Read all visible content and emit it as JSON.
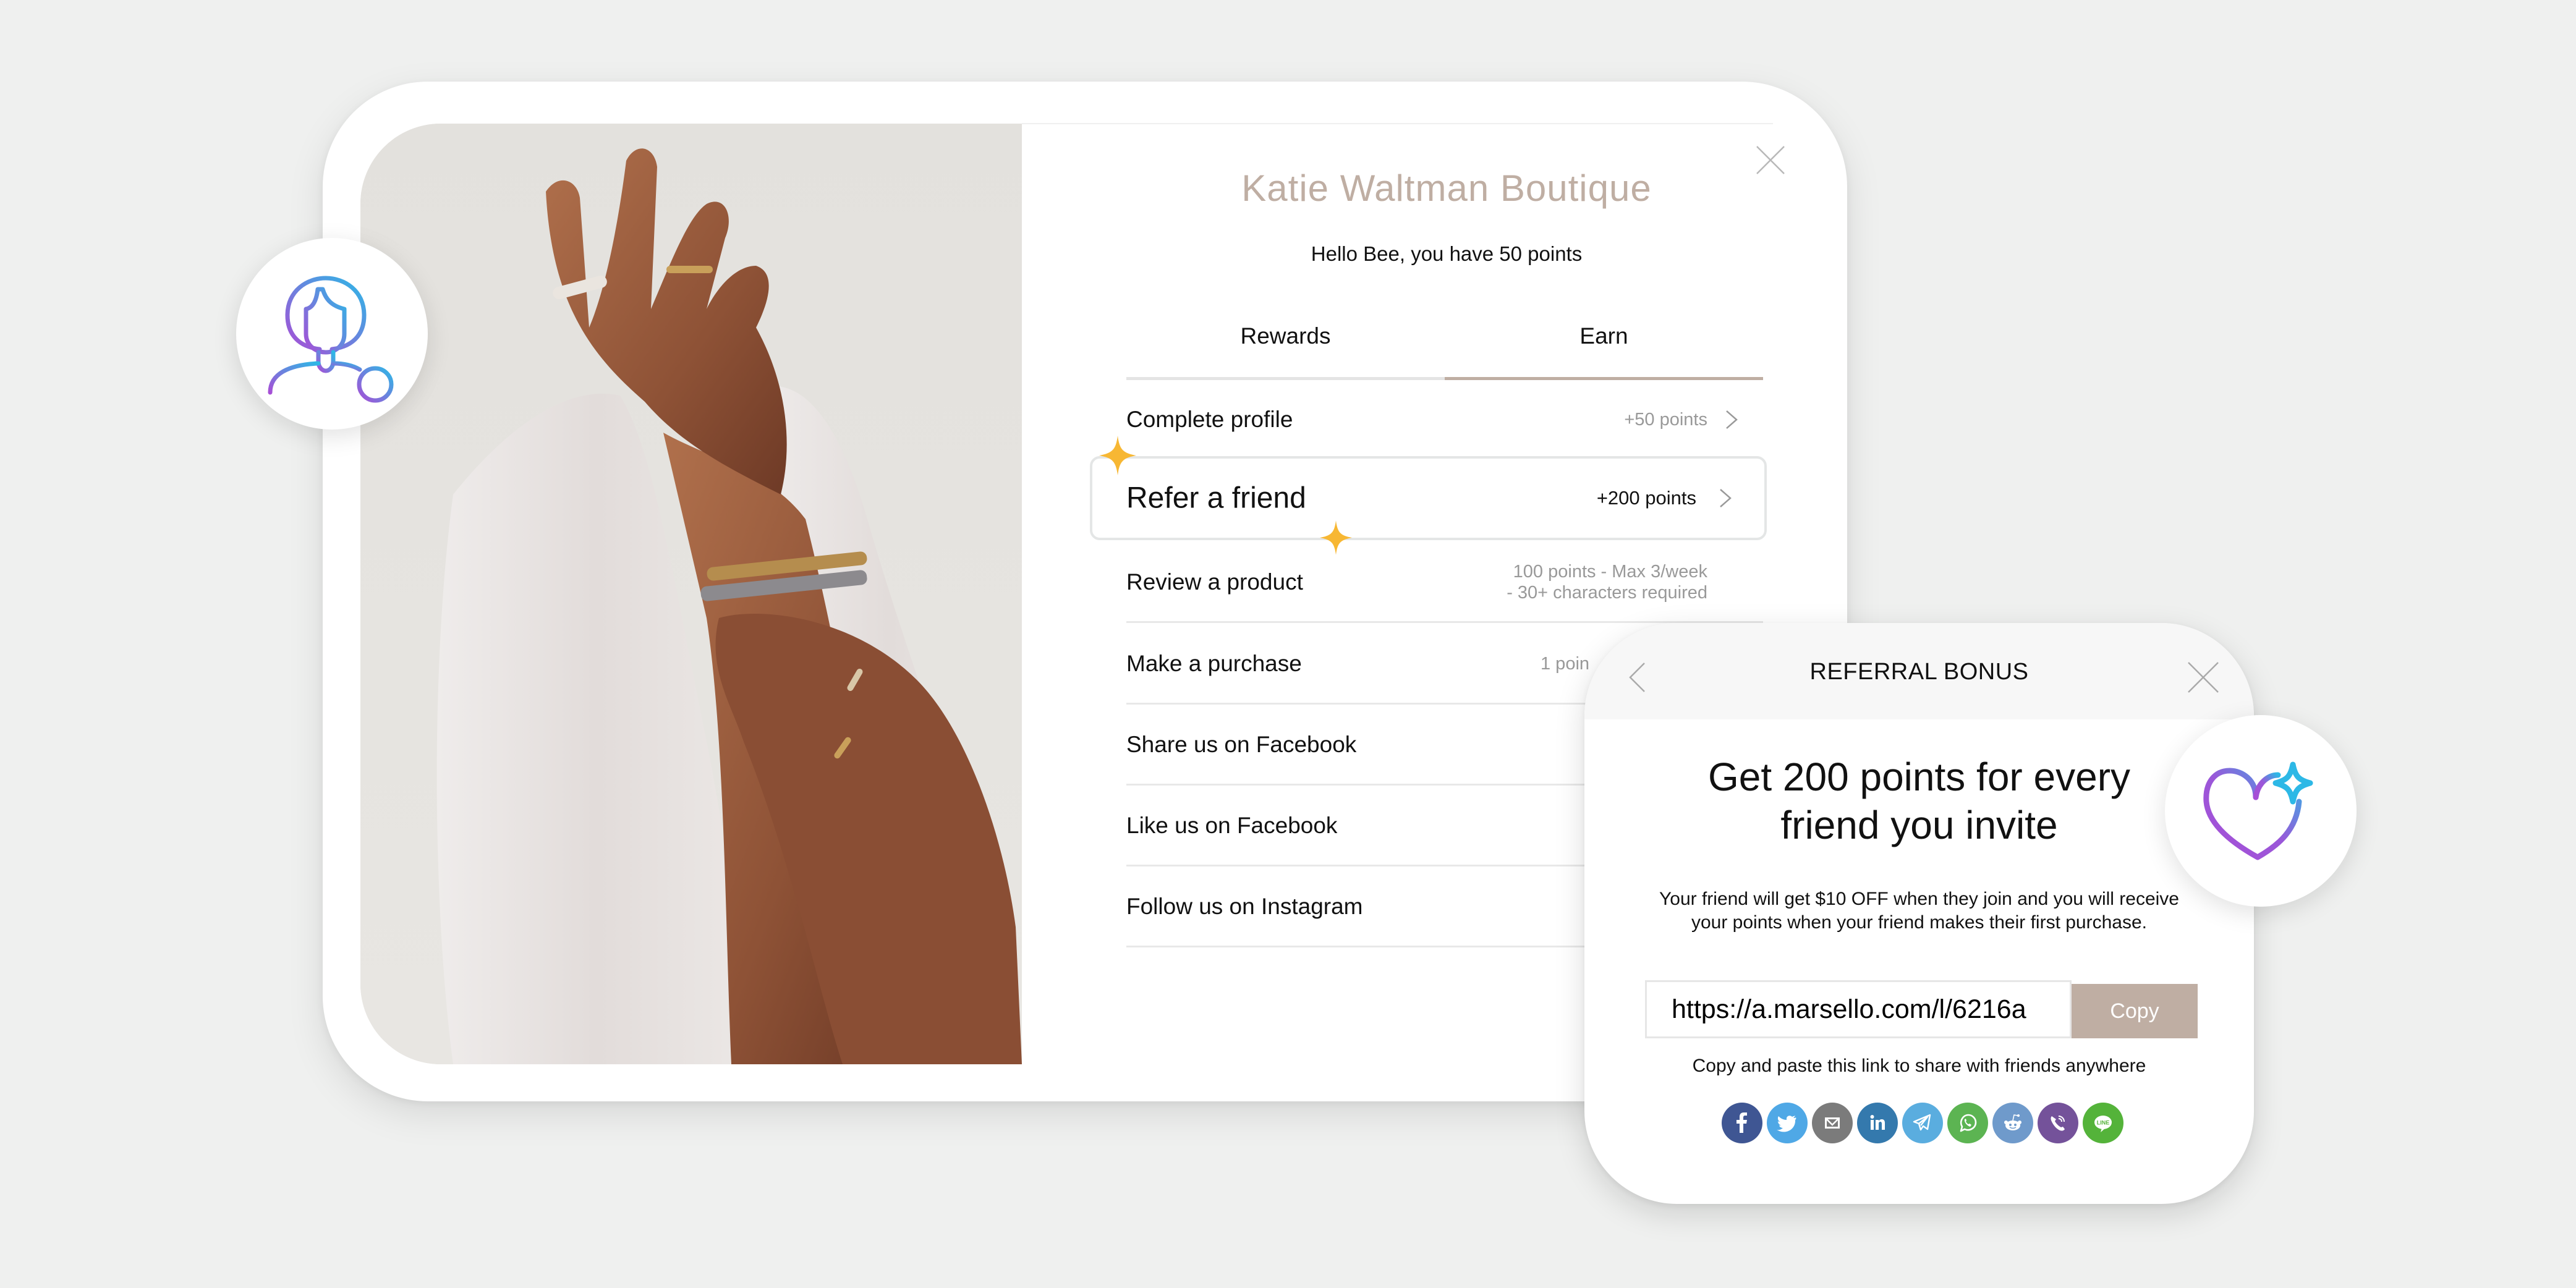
{
  "loyalty_widget": {
    "store_name": "Katie Waltman Boutique",
    "greeting": "Hello Bee, you have 50 points",
    "tabs": [
      {
        "label": "Rewards",
        "active": false
      },
      {
        "label": "Earn",
        "active": true
      }
    ],
    "earn_actions": [
      {
        "label": "Complete profile",
        "points": "+50 points"
      },
      {
        "label": "Refer a friend",
        "points": "+200 points",
        "highlighted": true
      },
      {
        "label": "Review a product",
        "points_line1": "100 points - Max 3/week",
        "points_line2": "- 30+ characters required"
      },
      {
        "label": "Make a purchase",
        "points": "1 poin"
      },
      {
        "label": "Share us on Facebook",
        "points": ""
      },
      {
        "label": "Like us on Facebook",
        "points": ""
      },
      {
        "label": "Follow us on Instagram",
        "points": ""
      }
    ],
    "icons": {
      "close": "close-icon",
      "chevron": "chevron-right-icon"
    }
  },
  "referral_popup": {
    "title": "REFERRAL BONUS",
    "headline_line1": "Get 200 points for every",
    "headline_line2": "friend you invite",
    "description": "Your friend will get $10 OFF when they join and you will receive your points when your friend makes their first purchase.",
    "referral_link": "https://a.marsello.com/l/6216a",
    "copy_label": "Copy",
    "hint": "Copy and paste this link to share with friends anywhere",
    "share_buttons": [
      {
        "name": "facebook",
        "color": "#3f5693"
      },
      {
        "name": "twitter",
        "color": "#4fa8e6"
      },
      {
        "name": "email",
        "color": "#7b7b7b"
      },
      {
        "name": "linkedin",
        "color": "#3479ad"
      },
      {
        "name": "telegram",
        "color": "#5aaddf"
      },
      {
        "name": "whatsapp",
        "color": "#5cb452"
      },
      {
        "name": "reddit",
        "color": "#6f9acb"
      },
      {
        "name": "viber",
        "color": "#74529a"
      },
      {
        "name": "line",
        "color": "#54b33a"
      }
    ],
    "line_label": "LINE"
  },
  "colors": {
    "accent": "#bfaea3",
    "background": "#eff0ef",
    "sparkle": "#f7b733",
    "gradient_start": "#a74fd6",
    "gradient_end": "#2db8e6"
  }
}
